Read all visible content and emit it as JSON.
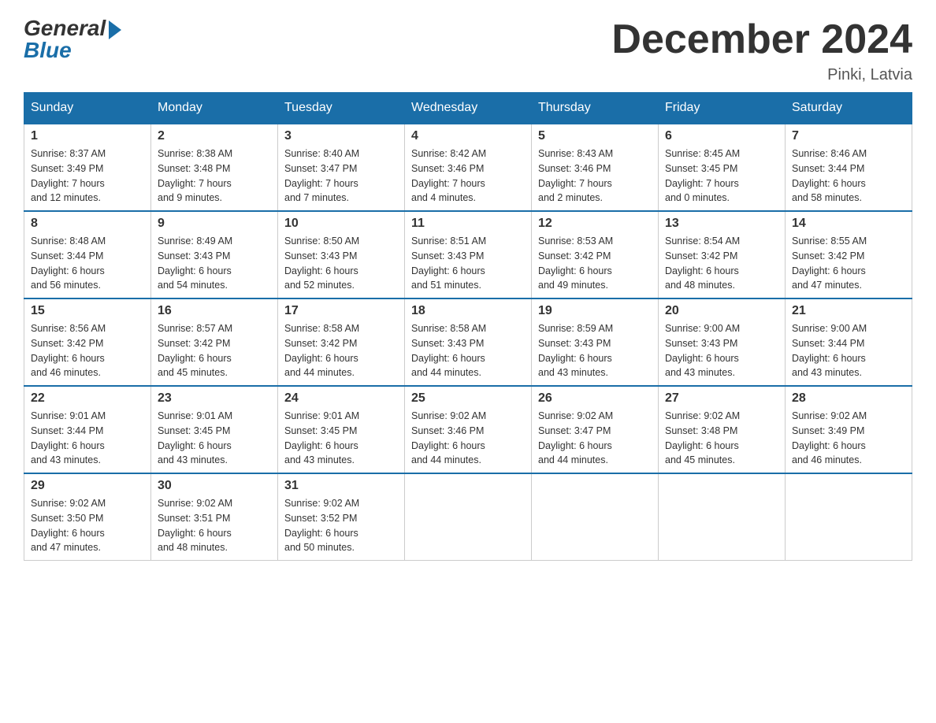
{
  "logo": {
    "general": "General",
    "blue": "Blue"
  },
  "title": "December 2024",
  "location": "Pinki, Latvia",
  "days_of_week": [
    "Sunday",
    "Monday",
    "Tuesday",
    "Wednesday",
    "Thursday",
    "Friday",
    "Saturday"
  ],
  "weeks": [
    [
      {
        "day": "1",
        "sunrise": "8:37 AM",
        "sunset": "3:49 PM",
        "daylight": "7 hours and 12 minutes."
      },
      {
        "day": "2",
        "sunrise": "8:38 AM",
        "sunset": "3:48 PM",
        "daylight": "7 hours and 9 minutes."
      },
      {
        "day": "3",
        "sunrise": "8:40 AM",
        "sunset": "3:47 PM",
        "daylight": "7 hours and 7 minutes."
      },
      {
        "day": "4",
        "sunrise": "8:42 AM",
        "sunset": "3:46 PM",
        "daylight": "7 hours and 4 minutes."
      },
      {
        "day": "5",
        "sunrise": "8:43 AM",
        "sunset": "3:46 PM",
        "daylight": "7 hours and 2 minutes."
      },
      {
        "day": "6",
        "sunrise": "8:45 AM",
        "sunset": "3:45 PM",
        "daylight": "7 hours and 0 minutes."
      },
      {
        "day": "7",
        "sunrise": "8:46 AM",
        "sunset": "3:44 PM",
        "daylight": "6 hours and 58 minutes."
      }
    ],
    [
      {
        "day": "8",
        "sunrise": "8:48 AM",
        "sunset": "3:44 PM",
        "daylight": "6 hours and 56 minutes."
      },
      {
        "day": "9",
        "sunrise": "8:49 AM",
        "sunset": "3:43 PM",
        "daylight": "6 hours and 54 minutes."
      },
      {
        "day": "10",
        "sunrise": "8:50 AM",
        "sunset": "3:43 PM",
        "daylight": "6 hours and 52 minutes."
      },
      {
        "day": "11",
        "sunrise": "8:51 AM",
        "sunset": "3:43 PM",
        "daylight": "6 hours and 51 minutes."
      },
      {
        "day": "12",
        "sunrise": "8:53 AM",
        "sunset": "3:42 PM",
        "daylight": "6 hours and 49 minutes."
      },
      {
        "day": "13",
        "sunrise": "8:54 AM",
        "sunset": "3:42 PM",
        "daylight": "6 hours and 48 minutes."
      },
      {
        "day": "14",
        "sunrise": "8:55 AM",
        "sunset": "3:42 PM",
        "daylight": "6 hours and 47 minutes."
      }
    ],
    [
      {
        "day": "15",
        "sunrise": "8:56 AM",
        "sunset": "3:42 PM",
        "daylight": "6 hours and 46 minutes."
      },
      {
        "day": "16",
        "sunrise": "8:57 AM",
        "sunset": "3:42 PM",
        "daylight": "6 hours and 45 minutes."
      },
      {
        "day": "17",
        "sunrise": "8:58 AM",
        "sunset": "3:42 PM",
        "daylight": "6 hours and 44 minutes."
      },
      {
        "day": "18",
        "sunrise": "8:58 AM",
        "sunset": "3:43 PM",
        "daylight": "6 hours and 44 minutes."
      },
      {
        "day": "19",
        "sunrise": "8:59 AM",
        "sunset": "3:43 PM",
        "daylight": "6 hours and 43 minutes."
      },
      {
        "day": "20",
        "sunrise": "9:00 AM",
        "sunset": "3:43 PM",
        "daylight": "6 hours and 43 minutes."
      },
      {
        "day": "21",
        "sunrise": "9:00 AM",
        "sunset": "3:44 PM",
        "daylight": "6 hours and 43 minutes."
      }
    ],
    [
      {
        "day": "22",
        "sunrise": "9:01 AM",
        "sunset": "3:44 PM",
        "daylight": "6 hours and 43 minutes."
      },
      {
        "day": "23",
        "sunrise": "9:01 AM",
        "sunset": "3:45 PM",
        "daylight": "6 hours and 43 minutes."
      },
      {
        "day": "24",
        "sunrise": "9:01 AM",
        "sunset": "3:45 PM",
        "daylight": "6 hours and 43 minutes."
      },
      {
        "day": "25",
        "sunrise": "9:02 AM",
        "sunset": "3:46 PM",
        "daylight": "6 hours and 44 minutes."
      },
      {
        "day": "26",
        "sunrise": "9:02 AM",
        "sunset": "3:47 PM",
        "daylight": "6 hours and 44 minutes."
      },
      {
        "day": "27",
        "sunrise": "9:02 AM",
        "sunset": "3:48 PM",
        "daylight": "6 hours and 45 minutes."
      },
      {
        "day": "28",
        "sunrise": "9:02 AM",
        "sunset": "3:49 PM",
        "daylight": "6 hours and 46 minutes."
      }
    ],
    [
      {
        "day": "29",
        "sunrise": "9:02 AM",
        "sunset": "3:50 PM",
        "daylight": "6 hours and 47 minutes."
      },
      {
        "day": "30",
        "sunrise": "9:02 AM",
        "sunset": "3:51 PM",
        "daylight": "6 hours and 48 minutes."
      },
      {
        "day": "31",
        "sunrise": "9:02 AM",
        "sunset": "3:52 PM",
        "daylight": "6 hours and 50 minutes."
      },
      null,
      null,
      null,
      null
    ]
  ],
  "labels": {
    "sunrise": "Sunrise:",
    "sunset": "Sunset:",
    "daylight": "Daylight:"
  }
}
